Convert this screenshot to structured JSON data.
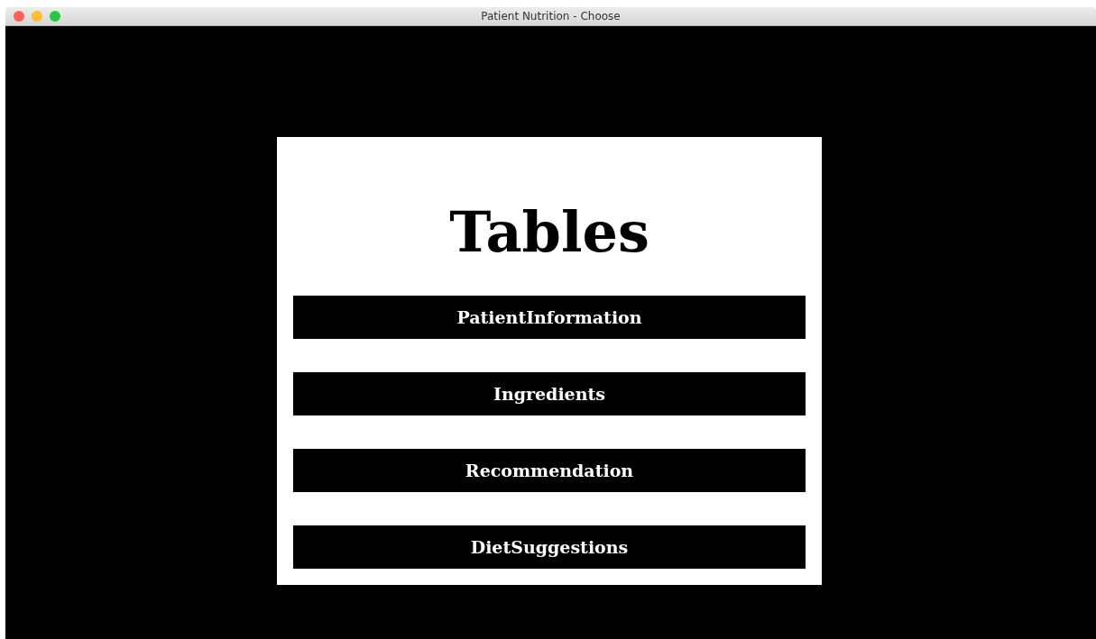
{
  "window": {
    "title": "Patient Nutrition - Choose"
  },
  "heading": "Tables",
  "buttons": [
    "PatientInformation",
    "Ingredients",
    "Recommendation",
    "DietSuggestions"
  ]
}
